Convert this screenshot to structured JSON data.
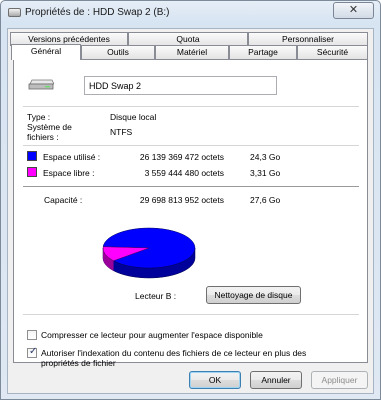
{
  "window": {
    "title": "Propriétés de : HDD Swap 2 (B:)",
    "close_glyph": "✕"
  },
  "tabs_top": [
    "Versions précédentes",
    "Quota",
    "Personnaliser"
  ],
  "tabs_bottom": [
    "Général",
    "Outils",
    "Matériel",
    "Partage",
    "Sécurité"
  ],
  "active_tab": "Général",
  "general": {
    "drive_name": "HDD Swap 2",
    "type_label": "Type :",
    "type_value": "Disque local",
    "fs_label_line1": "Système de",
    "fs_label_line2": "fichiers :",
    "fs_value": "NTFS",
    "used_label": "Espace utilisé :",
    "used_bytes": "26 139 369 472 octets",
    "used_size": "24,3 Go",
    "free_label": "Espace libre :",
    "free_bytes": "3 559 444 480 octets",
    "free_size": "3,31 Go",
    "capacity_label": "Capacité :",
    "capacity_bytes": "29 698 813 952 octets",
    "capacity_size": "27,6 Go",
    "drive_letter_label": "Lecteur B :",
    "cleanup_button": "Nettoyage de disque",
    "used_fraction": 0.8802,
    "used_color": "#0000ff",
    "free_color": "#ff00ff",
    "compress_label": "Compresser ce lecteur pour augmenter l'espace disponible",
    "compress_checked": false,
    "index_label_line1": "Autoriser l'indexation du contenu des fichiers de ce lecteur en plus des",
    "index_label_line2": "propriétés de fichier",
    "index_checked": true
  },
  "buttons": {
    "ok": "OK",
    "cancel": "Annuler",
    "apply": "Appliquer"
  }
}
